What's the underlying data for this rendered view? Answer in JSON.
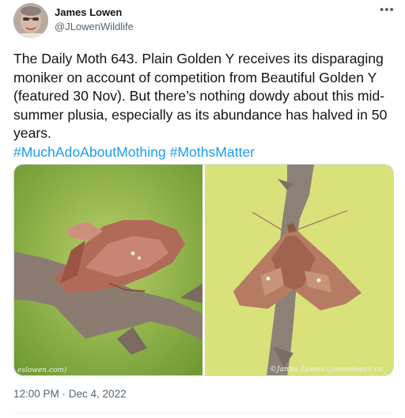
{
  "tweet": {
    "author_name": "James Lowen",
    "author_handle": "@JLowenWildlife",
    "more_icon": "more-horizontal-icon",
    "text": "The Daily Moth 643. Plain Golden Y receives its disparaging moniker on account of competition from Beautiful Golden Y (featured 30 Nov). But there’s nothing dowdy about this mid-summer plusia, especially as its abundance has halved in 50 years.",
    "hashtags": [
      "#MuchAdoAboutMothing",
      "#MothsMatter"
    ],
    "timestamp": "12:00 PM · Dec 4, 2022",
    "media": {
      "left_watermark": "eslowen.com)",
      "right_watermark": "©James Lowen (jameslowen.co"
    }
  },
  "colors": {
    "accent": "#1d9bf0",
    "secondary_text": "#536471"
  }
}
